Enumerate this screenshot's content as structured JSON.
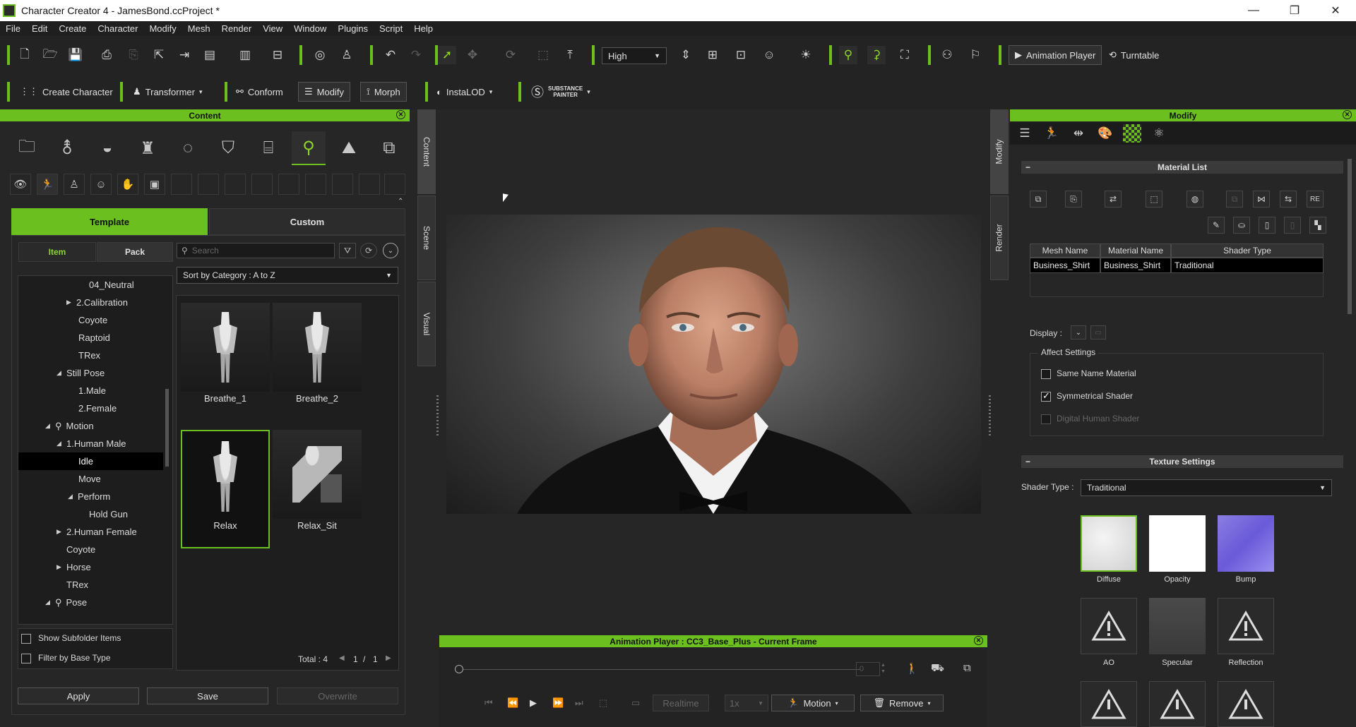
{
  "window": {
    "title": "Character Creator 4 - JamesBond.ccProject *",
    "controls": [
      "—",
      "❐",
      "✕"
    ]
  },
  "menu": [
    "File",
    "Edit",
    "Create",
    "Character",
    "Modify",
    "Mesh",
    "Render",
    "View",
    "Window",
    "Plugins",
    "Script",
    "Help"
  ],
  "toolbar": {
    "quality": "High",
    "animation_player": "Animation Player",
    "turntable": "Turntable",
    "create_character": "Create Character",
    "transformer": "Transformer",
    "conform": "Conform",
    "modify": "Modify",
    "morph": "Morph",
    "instalod": "InstaLOD",
    "substance_line1": "SUBSTANCE",
    "substance_line2": "PAINTER"
  },
  "content": {
    "title": "Content",
    "tabs": {
      "template": "Template",
      "custom": "Custom"
    },
    "subtabs": {
      "item": "Item",
      "pack": "Pack"
    },
    "search_placeholder": "Search",
    "sort": "Sort by Category : A to Z",
    "vtabs": {
      "content": "Content",
      "scene": "Scene",
      "visual": "Visual"
    },
    "tree": [
      "04_Neutral",
      "2.Calibration",
      "Coyote",
      "Raptoid",
      "TRex",
      "Still Pose",
      "1.Male",
      "2.Female",
      "Motion",
      "1.Human Male",
      "Idle",
      "Move",
      "Perform",
      "Hold Gun",
      "2.Human Female",
      "Coyote",
      "Horse",
      "TRex",
      "Pose"
    ],
    "thumbs": [
      "Breathe_1",
      "Breathe_2",
      "Relax",
      "Relax_Sit"
    ],
    "show_subfolder": "Show Subfolder Items",
    "filter_base": "Filter by Base Type",
    "total_label": "Total : 4",
    "page_current": "1",
    "page_sep": "/",
    "page_total": "1",
    "buttons": {
      "apply": "Apply",
      "save": "Save",
      "overwrite": "Overwrite"
    }
  },
  "anim": {
    "title": "Animation Player : CC3_Base_Plus - Current Frame",
    "frame": "0",
    "realtime": "Realtime",
    "speed": "1x",
    "motion": "Motion",
    "remove": "Remove"
  },
  "modify": {
    "title": "Modify",
    "vtabs": {
      "modify": "Modify",
      "render": "Render"
    },
    "material_list": "Material List",
    "columns": [
      "Mesh Name",
      "Material Name",
      "Shader Type"
    ],
    "row": [
      "Business_Shirt",
      "Business_Shirt",
      "Traditional"
    ],
    "display_label": "Display :",
    "affect_settings": "Affect Settings",
    "same_name_material": "Same Name Material",
    "symmetrical_shader": "Symmetrical Shader",
    "digital_human_shader": "Digital Human Shader",
    "texture_settings": "Texture Settings",
    "shader_type_label": "Shader Type :",
    "shader_type_value": "Traditional",
    "textures": [
      "Diffuse",
      "Opacity",
      "Bump",
      "AO",
      "Specular",
      "Reflection"
    ],
    "re_label": "RE"
  }
}
